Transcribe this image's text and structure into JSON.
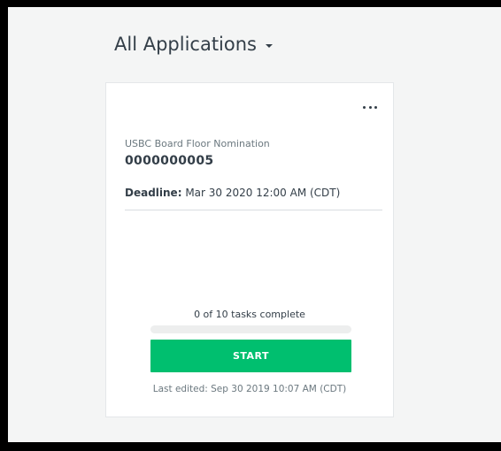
{
  "header": {
    "title": "All Applications",
    "dropdown_icon": "caret-down-icon"
  },
  "card": {
    "menu_icon": "more-horizontal-icon",
    "application_type": "USBC Board Floor Nomination",
    "application_id": "0000000005",
    "deadline_label": "Deadline:",
    "deadline_value": "Mar 30 2020 12:00 AM (CDT)",
    "progress_text": "0 of 10 tasks complete",
    "progress_fraction": 0,
    "start_label": "START",
    "last_edited": "Last edited: Sep 30 2019 10:07 AM (CDT)"
  },
  "colors": {
    "accent": "#00bf6f",
    "text_primary": "#333e48",
    "text_secondary": "#6b787f",
    "background": "#f4f5f5"
  }
}
